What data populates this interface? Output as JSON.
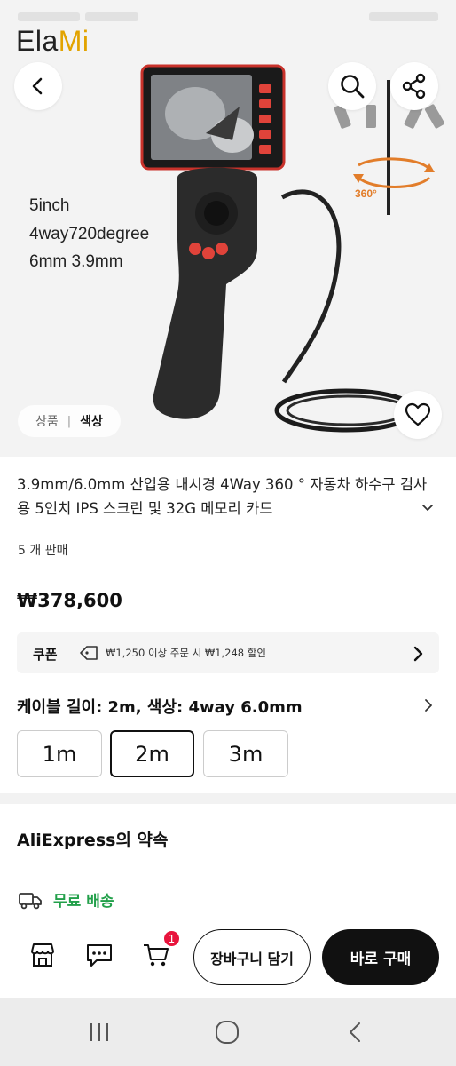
{
  "brand": {
    "part1": "Ela",
    "part2": "Mi"
  },
  "hero": {
    "specs": [
      "5inch",
      "4way720degree",
      "6mm 3.9mm"
    ],
    "badge_360": "360°",
    "tabs": [
      "상품",
      "색상"
    ],
    "tab_separator": "|",
    "icons": {
      "back": "chevron-left-icon",
      "search": "search-icon",
      "share": "share-icon",
      "wishlist": "heart-icon"
    }
  },
  "product": {
    "title": "3.9mm/6.0mm 산업용 내시경 4Way 360 °  자동차 하수구 검사용 5인치 IPS 스크린 및 32G 메모리 카드",
    "sold": "5 개 판매",
    "price": "₩378,600"
  },
  "coupon": {
    "label": "쿠폰",
    "text": "₩1,250 이상 주문 시 ₩1,248 할인"
  },
  "variant": {
    "summary": "케이블 길이: 2m, 색상: 4way 6.0mm",
    "options": [
      "1m",
      "2m",
      "3m"
    ],
    "selected": "2m"
  },
  "promise": {
    "title": "AliExpress의 약속",
    "shipping": "무료 배송"
  },
  "actions": {
    "cart_count": "1",
    "add_to_cart": "장바구니 담기",
    "buy_now": "바로 구매"
  },
  "colors": {
    "brand_accent": "#e2a300",
    "free_shipping": "#22a04a",
    "cart_badge": "#e8143c",
    "buy_button": "#111111"
  }
}
